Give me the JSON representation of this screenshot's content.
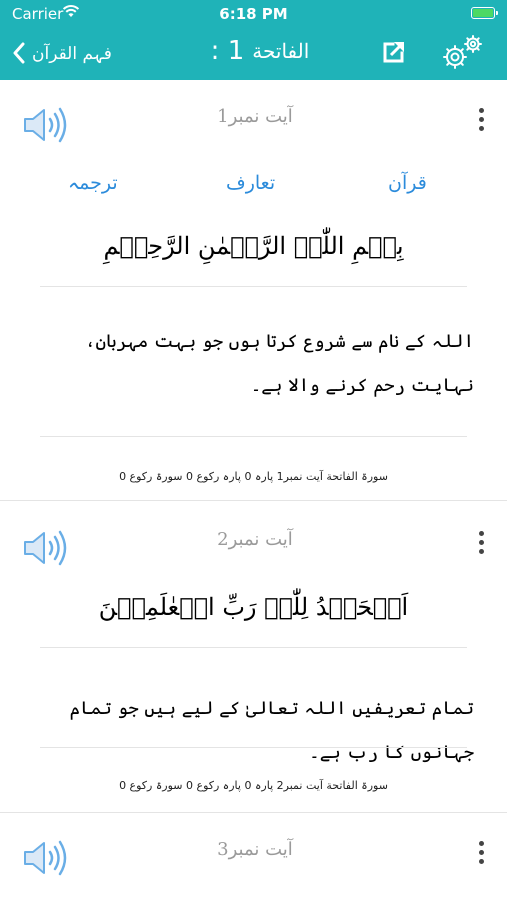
{
  "status_bar": {
    "carrier": "Carrier",
    "time": "6:18 PM"
  },
  "nav": {
    "back_label": "فہم القرآن",
    "sura_name": "الفاتحة",
    "sura_number": ": 1"
  },
  "tabs": {
    "tarjama": "ترجمہ",
    "taaruf": "تعارف",
    "quran": "قرآن"
  },
  "ayahs": [
    {
      "label": "آیت نمبر1",
      "arabic": "بِسۡمِ اللّٰہِ الرَّحۡمٰنِ الرَّحِیۡمِ",
      "urdu": "اللہ کے نام سے شروع کرتا ہوں جو بہت مہربان، نہایت رحم کرنے والا ہے۔",
      "meta": "سورۃ الفاتحة  آیت نمبر1  پارہ 0  پارہ رکوع 0  سورۃ رکوع 0"
    },
    {
      "label": "آیت نمبر2",
      "arabic": "اَلۡحَمۡدُ لِلّٰہِ رَبِّ الۡعٰلَمِیۡنَ",
      "urdu": "تمام تعریفیں اللہ تعالیٰ کے لیے ہیں جو تمام جہانوں کا رب ہے۔",
      "meta": "سورۃ الفاتحة  آیت نمبر2  پارہ 0  پارہ رکوع 0  سورۃ رکوع 0"
    },
    {
      "label": "آیت نمبر3"
    }
  ],
  "colors": {
    "header": "#1fb3b8",
    "tab_link": "#2b8bdb",
    "speaker": "#6aaee6"
  },
  "icons": [
    "wifi-icon",
    "battery-icon",
    "chevron-left-icon",
    "share-icon",
    "gear-icon",
    "speaker-icon",
    "more-vertical-icon"
  ]
}
